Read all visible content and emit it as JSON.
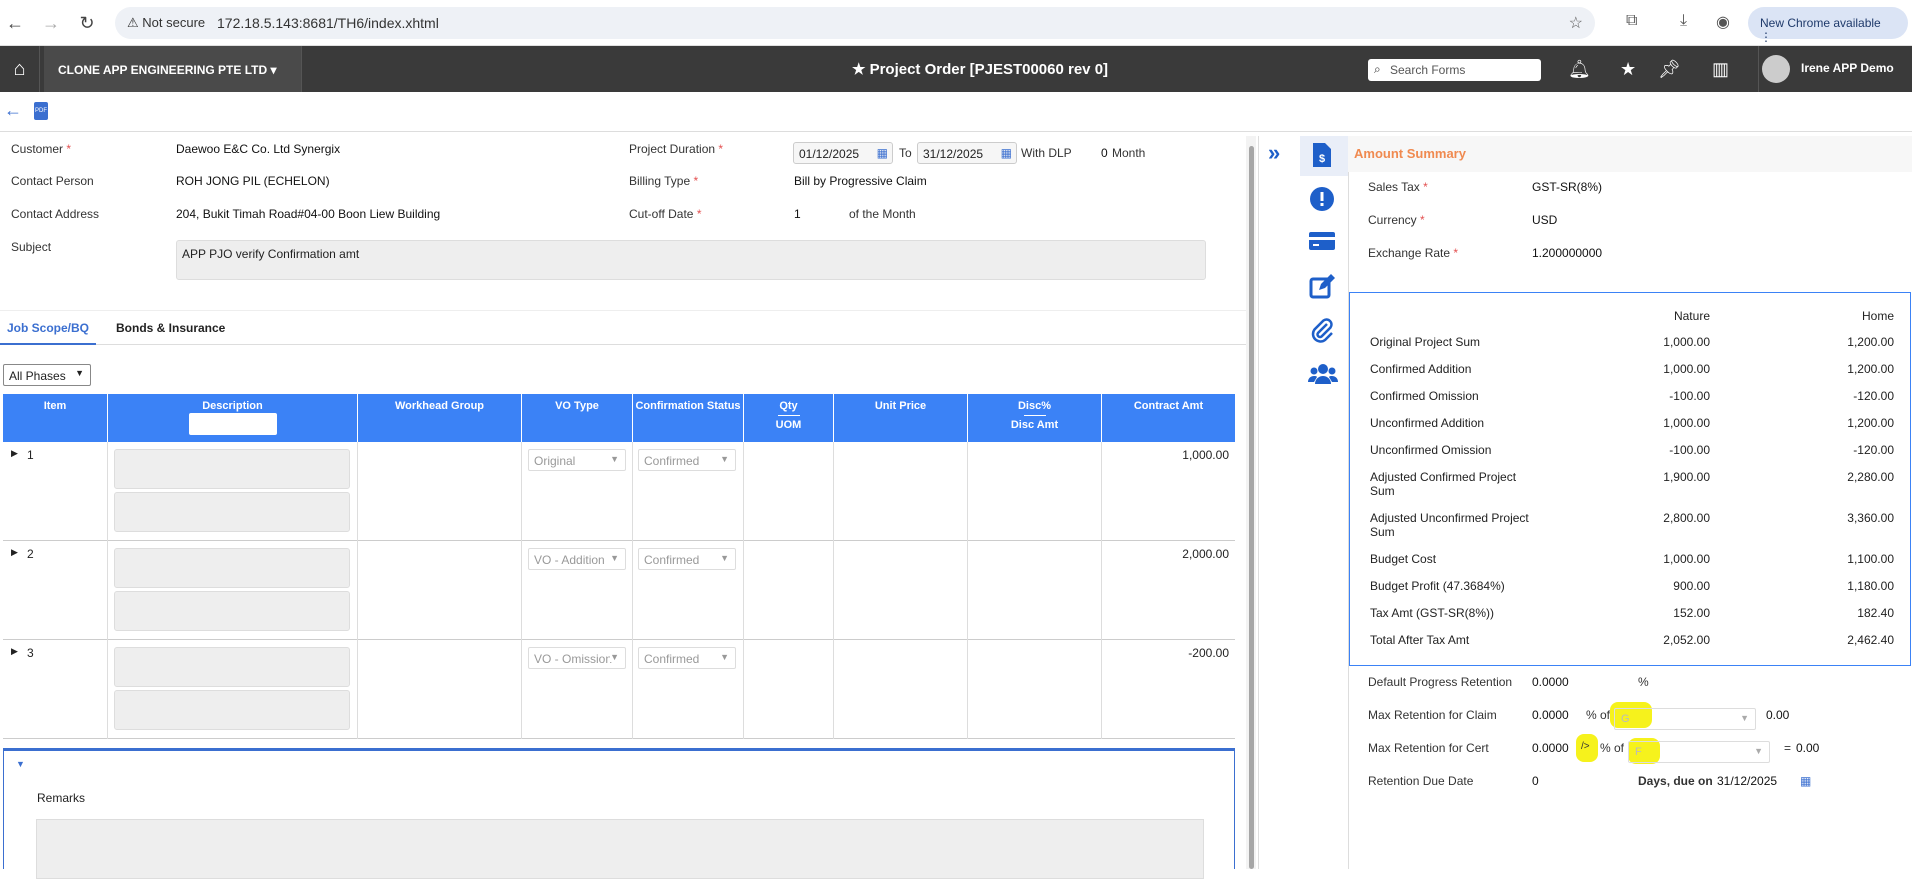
{
  "browser": {
    "security": "Not secure",
    "url": "172.18.5.143:8681/TH6/index.xhtml",
    "new_chrome": "New Chrome available"
  },
  "appbar": {
    "company": "CLONE APP ENGINEERING PTE LTD",
    "title": "Project Order [PJEST00060 rev 0]",
    "search_placeholder": "Search Forms",
    "user": "Irene APP Demo"
  },
  "form": {
    "customer_label": "Customer",
    "customer": "Daewoo E&C Co. Ltd Synergix",
    "contact_person_label": "Contact Person",
    "contact_person": "ROH JONG PIL (ECHELON)",
    "contact_address_label": "Contact Address",
    "contact_address": "204, Bukit Timah Road#04-00 Boon Liew Building",
    "subject_label": "Subject",
    "subject": "APP PJO verify Confirmation amt",
    "duration_label": "Project Duration",
    "date_from": "01/12/2025",
    "to_label": "To",
    "date_to": "31/12/2025",
    "dlp_label": "With DLP",
    "dlp_value": "0",
    "dlp_unit": "Month",
    "billing_label": "Billing Type",
    "billing": "Bill by Progressive Claim",
    "cutoff_label": "Cut-off Date",
    "cutoff": "1",
    "cutoff_suffix": "of the Month"
  },
  "tabs": [
    "Job Scope/BQ",
    "Bonds & Insurance"
  ],
  "phases": "All Phases",
  "grid": {
    "headers": {
      "item": "Item",
      "description": "Description",
      "workhead": "Workhead Group",
      "vo_type": "VO Type",
      "confirmation": "Confirmation Status",
      "qty": "Qty",
      "uom": "UOM",
      "unit_price": "Unit Price",
      "disc_pct": "Disc%",
      "disc_amt": "Disc Amt",
      "contract_amt": "Contract Amt"
    },
    "rows": [
      {
        "item": "1",
        "vo_type": "Original",
        "status": "Confirmed",
        "amt": "1,000.00"
      },
      {
        "item": "2",
        "vo_type": "VO - Addition",
        "status": "Confirmed",
        "amt": "2,000.00"
      },
      {
        "item": "3",
        "vo_type": "VO - Omission",
        "status": "Confirmed",
        "amt": "-200.00"
      }
    ]
  },
  "remarks_label": "Remarks",
  "summary": {
    "title": "Amount Summary",
    "sales_tax_label": "Sales Tax",
    "sales_tax": "GST-SR(8%)",
    "currency_label": "Currency",
    "currency": "USD",
    "exrate_label": "Exchange Rate",
    "exrate": "1.200000000",
    "col_nature": "Nature",
    "col_home": "Home",
    "rows": [
      {
        "label": "Original Project Sum",
        "nature": "1,000.00",
        "home": "1,200.00"
      },
      {
        "label": "Confirmed Addition",
        "nature": "1,000.00",
        "home": "1,200.00"
      },
      {
        "label": "Confirmed Omission",
        "nature": "-100.00",
        "home": "-120.00"
      },
      {
        "label": "Unconfirmed Addition",
        "nature": "1,000.00",
        "home": "1,200.00"
      },
      {
        "label": "Unconfirmed Omission",
        "nature": "-100.00",
        "home": "-120.00"
      },
      {
        "label": "Adjusted Confirmed Project Sum",
        "nature": "1,900.00",
        "home": "2,280.00"
      },
      {
        "label": "Adjusted Unconfirmed Project Sum",
        "nature": "2,800.00",
        "home": "3,360.00"
      },
      {
        "label": "Budget Cost",
        "nature": "1,000.00",
        "home": "1,100.00"
      },
      {
        "label": "Budget Profit (47.3684%)",
        "nature": "900.00",
        "home": "1,180.00"
      },
      {
        "label": "Tax Amt  (GST-SR(8%))",
        "nature": "152.00",
        "home": "182.40"
      },
      {
        "label": "Total After Tax Amt",
        "nature": "2,052.00",
        "home": "2,462.40"
      }
    ],
    "retention": {
      "default_label": "Default Progress Retention",
      "default_value": "0.0000",
      "pct": "%",
      "max_claim_label": "Max Retention for Claim",
      "max_claim_value": "0.0000",
      "pct_of": "% of",
      "claim_sel": "G",
      "claim_amt": "0.00",
      "max_cert_label": "Max Retention for Cert",
      "max_cert_value": "0.0000",
      "cert_tag": "/>",
      "cert_sel": "F",
      "equals": "=",
      "cert_amt": "0.00",
      "due_label": "Retention Due Date",
      "due_value": "0",
      "due_text": "Days, due on",
      "due_date": "31/12/2025"
    }
  }
}
